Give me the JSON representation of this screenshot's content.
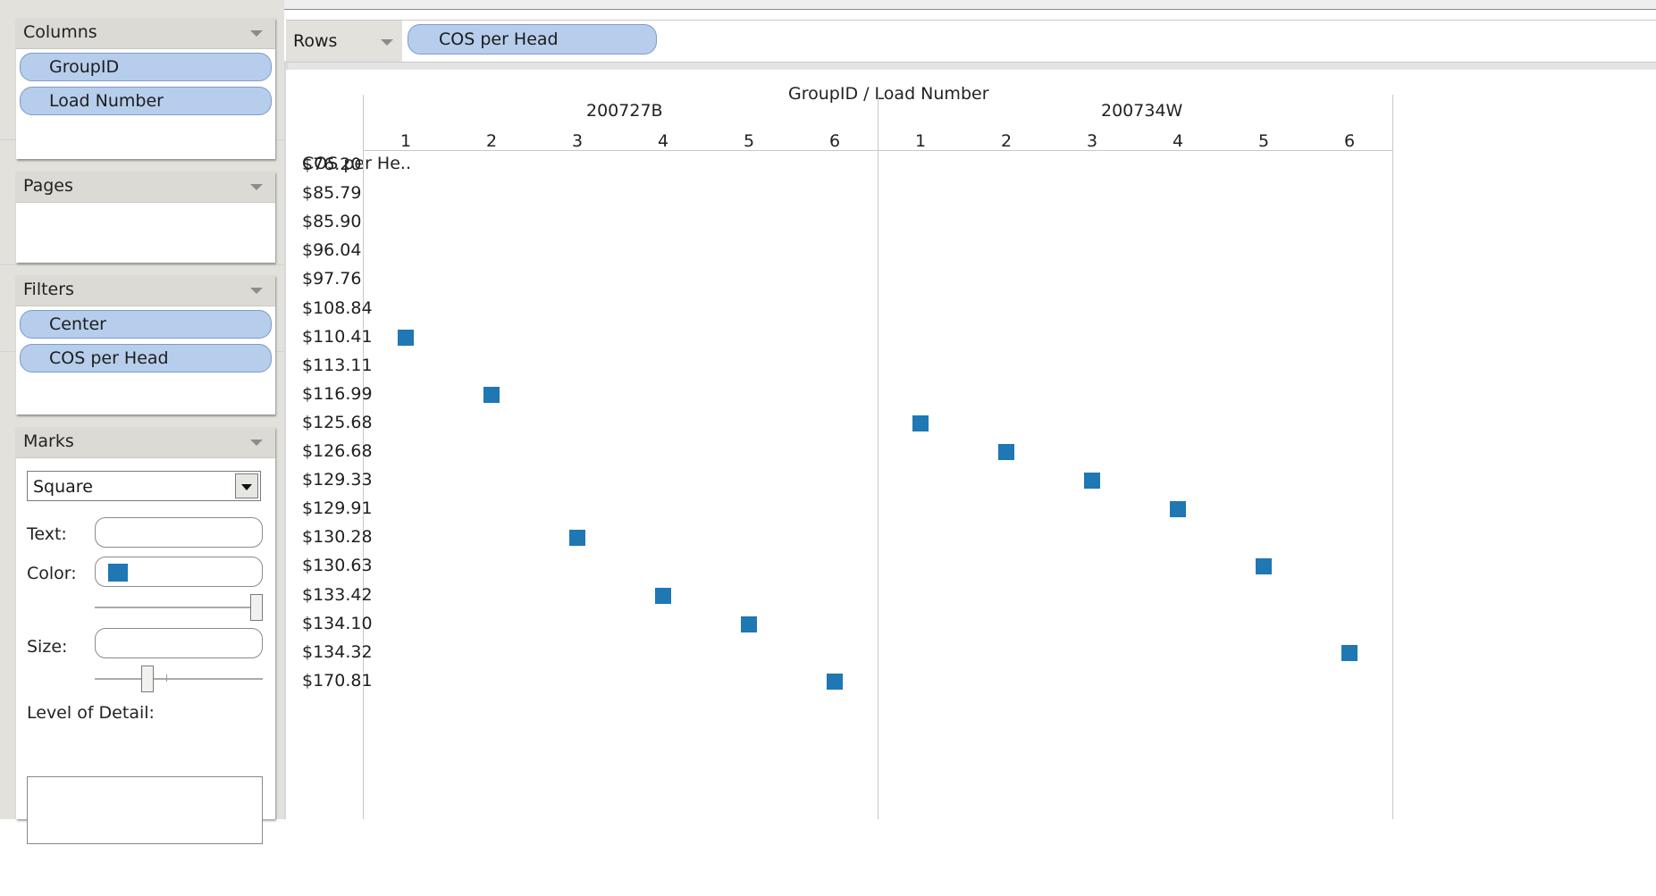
{
  "colors": {
    "mark": "#1f77b4",
    "pill": "#b7cdec",
    "panel_bg": "#e2e1dc"
  },
  "sidebar": {
    "columns": {
      "title": "Columns",
      "pills": [
        "GroupID",
        "Load Number"
      ]
    },
    "pages": {
      "title": "Pages"
    },
    "filters": {
      "title": "Filters",
      "pills": [
        "Center",
        "COS per Head"
      ]
    },
    "marks": {
      "title": "Marks",
      "mark_type": "Square",
      "text_label": "Text:",
      "color_label": "Color:",
      "size_label": "Size:",
      "lod_label": "Level of Detail:",
      "color_swatch": "#1f77b4",
      "opacity_level": 1.0,
      "size_level": 0.3
    }
  },
  "rows_shelf": {
    "label": "Rows",
    "pill": "COS per Head"
  },
  "chart_data": {
    "type": "scatter",
    "column_header_title": "GroupID  /  Load Number",
    "row_header_title": "COS per He..",
    "groups": [
      {
        "name": "200727B",
        "load_numbers": [
          "1",
          "2",
          "3",
          "4",
          "5",
          "6"
        ]
      },
      {
        "name": "200734W",
        "load_numbers": [
          "1",
          "2",
          "3",
          "4",
          "5",
          "6"
        ]
      }
    ],
    "rows": [
      "$76.20",
      "$85.79",
      "$85.90",
      "$96.04",
      "$97.76",
      "$108.84",
      "$110.41",
      "$113.11",
      "$116.99",
      "$125.68",
      "$126.68",
      "$129.33",
      "$129.91",
      "$130.28",
      "$130.63",
      "$133.42",
      "$134.10",
      "$134.32",
      "$170.81"
    ],
    "points": [
      {
        "group": "200727B",
        "load": "1",
        "cos": "$110.41"
      },
      {
        "group": "200727B",
        "load": "2",
        "cos": "$116.99"
      },
      {
        "group": "200727B",
        "load": "3",
        "cos": "$130.28"
      },
      {
        "group": "200727B",
        "load": "4",
        "cos": "$133.42"
      },
      {
        "group": "200727B",
        "load": "5",
        "cos": "$134.10"
      },
      {
        "group": "200727B",
        "load": "6",
        "cos": "$170.81"
      },
      {
        "group": "200734W",
        "load": "1",
        "cos": "$125.68"
      },
      {
        "group": "200734W",
        "load": "2",
        "cos": "$126.68"
      },
      {
        "group": "200734W",
        "load": "3",
        "cos": "$129.33"
      },
      {
        "group": "200734W",
        "load": "4",
        "cos": "$129.91"
      },
      {
        "group": "200734W",
        "load": "5",
        "cos": "$130.63"
      },
      {
        "group": "200734W",
        "load": "6",
        "cos": "$134.32"
      }
    ]
  }
}
